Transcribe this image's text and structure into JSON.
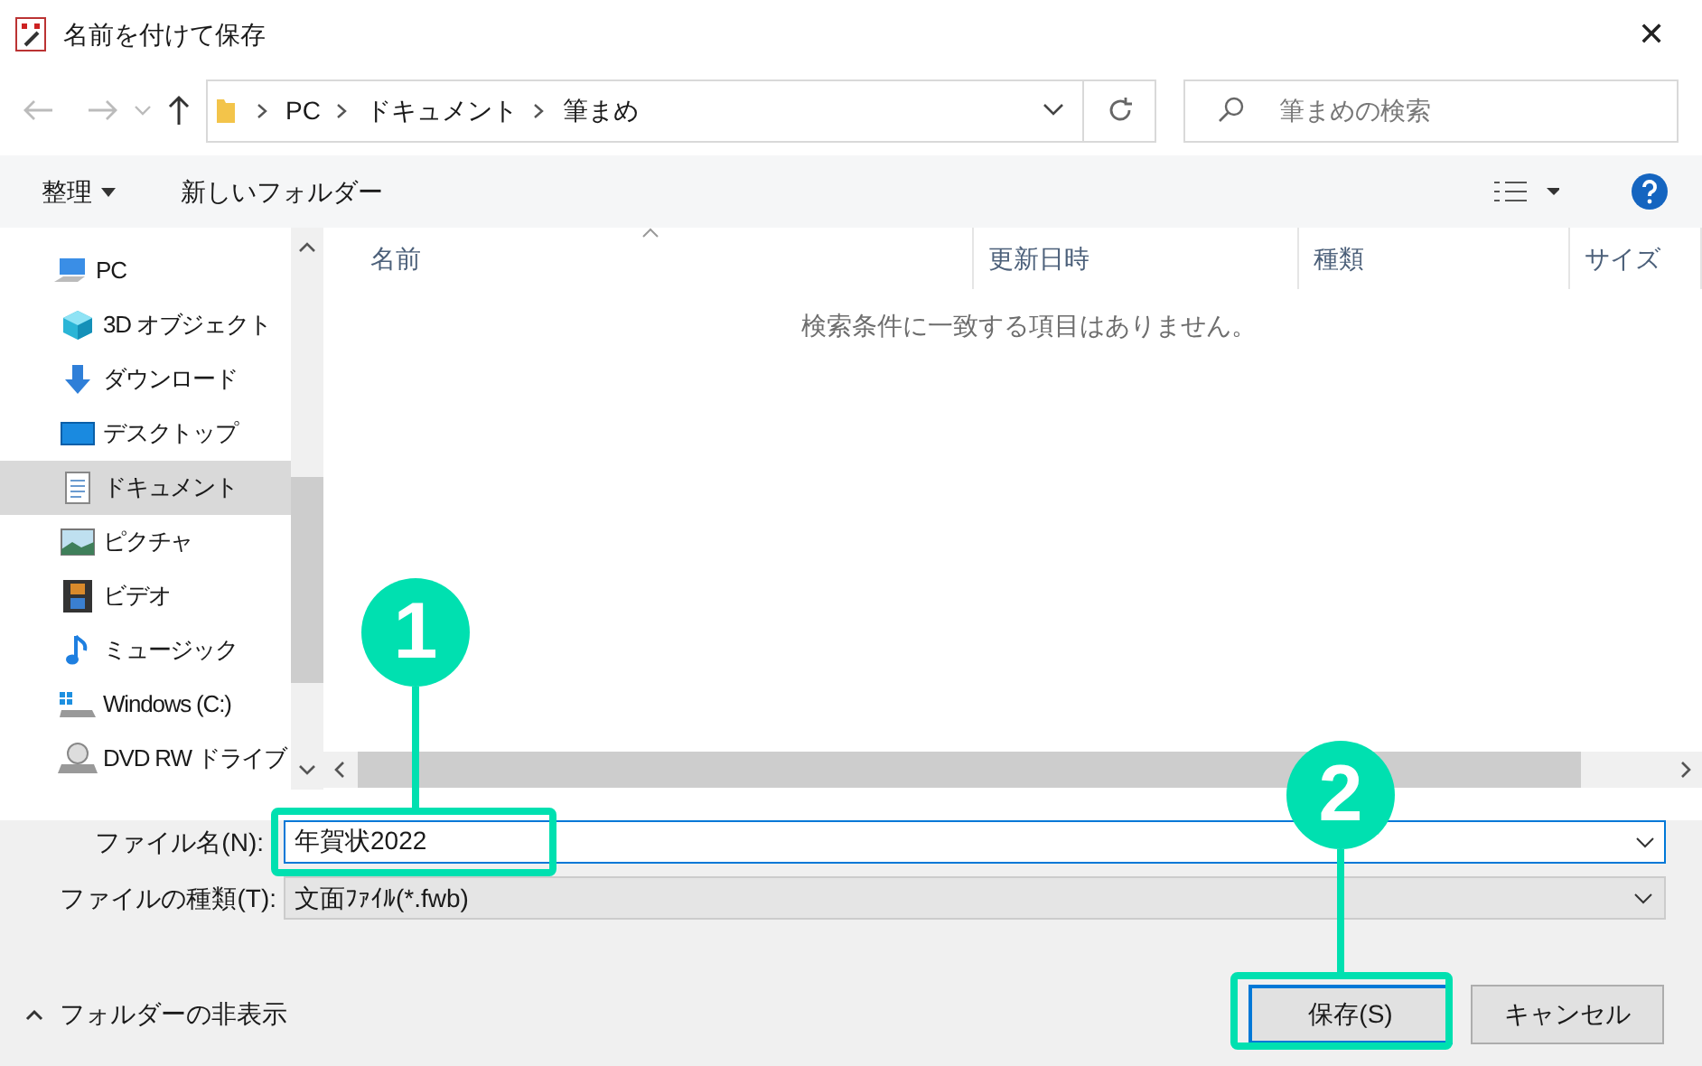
{
  "window": {
    "title": "名前を付けて保存",
    "close": "✕"
  },
  "address": {
    "segments": [
      "PC",
      "ドキュメント",
      "筆まめ"
    ]
  },
  "search": {
    "placeholder": "筆まめの検索"
  },
  "toolbar": {
    "organize": "整理",
    "new_folder": "新しいフォルダー"
  },
  "sidebar": {
    "items": [
      {
        "label": "PC",
        "kind": "pc",
        "selected": false,
        "children": [
          {
            "label": "3D オブジェクト",
            "kind": "cube",
            "selected": false
          },
          {
            "label": "ダウンロード",
            "kind": "download",
            "selected": false
          },
          {
            "label": "デスクトップ",
            "kind": "desktop",
            "selected": false
          },
          {
            "label": "ドキュメント",
            "kind": "document",
            "selected": true
          },
          {
            "label": "ピクチャ",
            "kind": "picture",
            "selected": false
          },
          {
            "label": "ビデオ",
            "kind": "video",
            "selected": false
          },
          {
            "label": "ミュージック",
            "kind": "music",
            "selected": false
          },
          {
            "label": "Windows (C:)",
            "kind": "drive",
            "selected": false
          },
          {
            "label": "DVD RW ドライブ",
            "kind": "dvd",
            "selected": false
          }
        ]
      }
    ]
  },
  "table": {
    "columns": [
      "名前",
      "更新日時",
      "種類",
      "サイズ"
    ],
    "empty_message": "検索条件に一致する項目はありません。"
  },
  "file_name": {
    "label": "ファイル名(N):",
    "value": "年賀状2022"
  },
  "file_type": {
    "label": "ファイルの種類(T):",
    "value": "文面ﾌｧｲﾙ(*.fwb)"
  },
  "hide_folders": "フォルダーの非表示",
  "buttons": [
    {
      "label": "保存(S)",
      "kind": "primary"
    },
    {
      "label": "キャンセル",
      "kind": "normal"
    }
  ],
  "annotations": [
    {
      "label": "1"
    },
    {
      "label": "2"
    }
  ]
}
